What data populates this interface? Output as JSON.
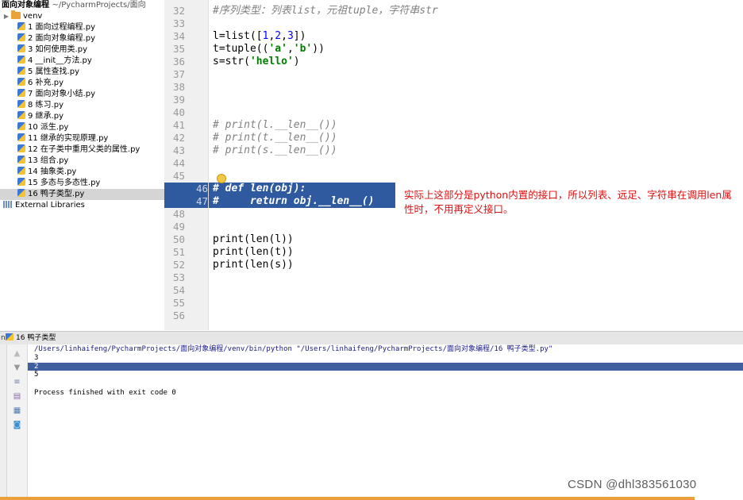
{
  "project": {
    "root_name": "面向对象编程",
    "root_path": "~/PycharmProjects/面向",
    "folder": "venv",
    "files": [
      "1 面向过程编程.py",
      "2 面向对象编程.py",
      "3 如何使用类.py",
      "4 __init__方法.py",
      "5 属性查找.py",
      "6 补充.py",
      "7 面向对象小结.py",
      "8 练习.py",
      "9 继承.py",
      "10 派生.py",
      "11 继承的实现原理.py",
      "12 在子类中重用父类的属性.py",
      "13 组合.py",
      "14 抽象类.py",
      "15 多态与多态性.py",
      "16 鸭子类型.py"
    ],
    "selected_index": 15,
    "libraries": "External Libraries"
  },
  "editor": {
    "line_numbers": [
      "32",
      "33",
      "34",
      "35",
      "36",
      "37",
      "38",
      "39",
      "40",
      "41",
      "42",
      "43",
      "44",
      "45",
      "46",
      "47",
      "48",
      "49",
      "50",
      "51",
      "52",
      "53",
      "54",
      "55",
      "56"
    ],
    "lines": {
      "l32": "#序列类型：列表list，元祖tuple，字符串str",
      "l34": "l=list([1,2,3])",
      "l35": "t=tuple(('a','b'))",
      "l36": "s=str('hello')",
      "l41": "# print(l.__len__())",
      "l42": "# print(t.__len__())",
      "l43": "# print(s.__len__())",
      "l46": "# def len(obj):",
      "l47": "#     return obj.__len__()",
      "l50": "print(len(l))",
      "l51": "print(len(t))",
      "l52": "print(len(s))"
    },
    "annotation": "实际上这部分是python内置的接口，所以列表、远足、字符串在调用len属性时，不用再定义接口。"
  },
  "run": {
    "tab_prefix": "n",
    "tab_title": "16 鸭子类型",
    "command": "/Users/linhaifeng/PycharmProjects/面向对象编程/venv/bin/python \"/Users/linhaifeng/PycharmProjects/面向对象编程/16 鸭子类型.py\"",
    "output": [
      "3",
      "2",
      "5"
    ],
    "finish": "Process finished with exit code 0"
  },
  "watermark": "CSDN @dhl383561030"
}
